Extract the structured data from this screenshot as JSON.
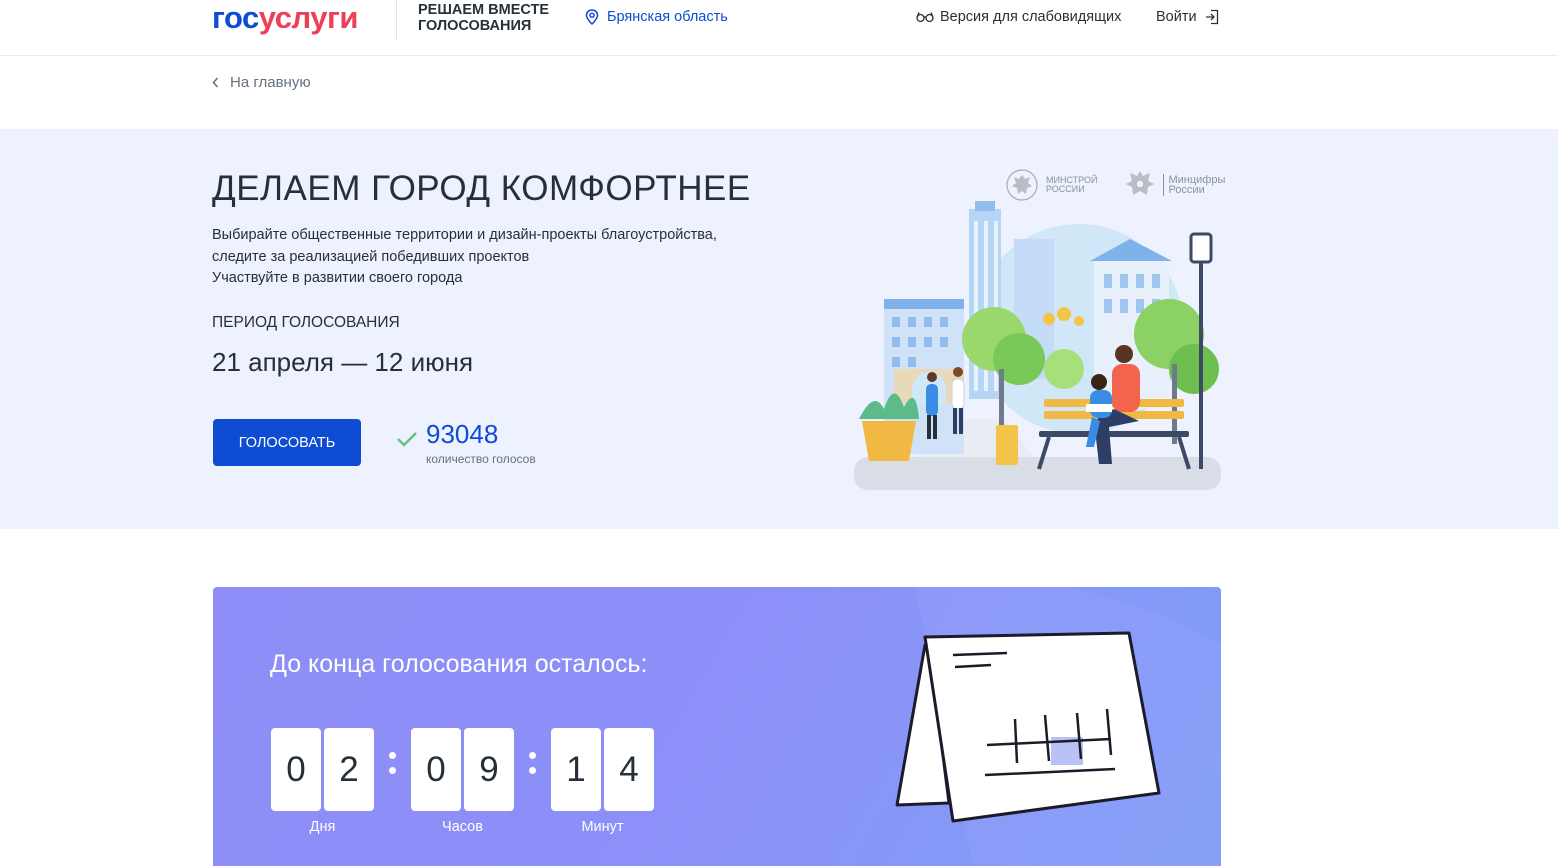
{
  "header": {
    "logo_gos": "гос",
    "logo_uslugi": "услуги",
    "tagline_line1": "РЕШАЕМ ВМЕСТЕ",
    "tagline_line2": "ГОЛОСОВАНИЯ",
    "region": "Брянская область",
    "vision_label": "Версия для слабовидящих",
    "login_label": "Войти"
  },
  "nav": {
    "back_label": "На главную"
  },
  "hero": {
    "title": "ДЕЛАЕМ ГОРОД КОМФОРТНЕЕ",
    "desc_line1": "Выбирайте общественные территории и дизайн-проекты благоустройства,",
    "desc_line2": "следите за реализацией победивших проектов",
    "desc_line3": "Участвуйте в развитии своего города",
    "period_label": "ПЕРИОД ГОЛОСОВАНИЯ",
    "period_value": "21 апреля — 12 июня",
    "vote_button": "ГОЛОСОВАТЬ",
    "votes_count": "93048",
    "votes_label": "количество голосов",
    "ministry1_line1": "МИНСТРОЙ",
    "ministry1_line2": "РОССИИ",
    "ministry2_line1": "Минцифры",
    "ministry2_line2": "России"
  },
  "countdown": {
    "title": "До конца голосования осталось:",
    "days": [
      "0",
      "2"
    ],
    "hours": [
      "0",
      "9"
    ],
    "minutes": [
      "1",
      "4"
    ],
    "days_label": "Дня",
    "hours_label": "Часов",
    "minutes_label": "Минут"
  },
  "colors": {
    "primary": "#0d4cd3",
    "logo_red": "#ee3f58",
    "hero_bg": "#edf2fe",
    "countdown_bg": "#8e8df7",
    "check_green": "#5ec47a"
  }
}
